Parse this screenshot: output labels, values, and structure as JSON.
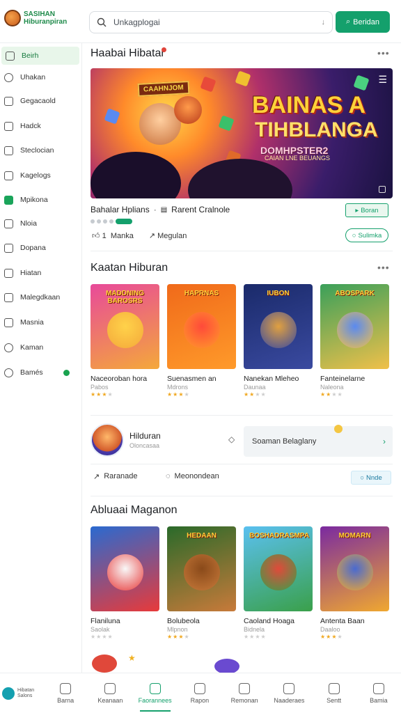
{
  "app": {
    "logo_text": "SASIHAN Hiburanpiran"
  },
  "search": {
    "placeholder": "Unkagplogai",
    "button_label": "Beridan"
  },
  "sidebar": {
    "items": [
      {
        "label": "Beirh",
        "icon": "home-icon",
        "active": true
      },
      {
        "label": "Uhakan",
        "icon": "bell-icon"
      },
      {
        "label": "Gegacaold",
        "icon": "game-icon"
      },
      {
        "label": "Hadck",
        "icon": "folder-icon"
      },
      {
        "label": "Steclocian",
        "icon": "home-outline-icon"
      },
      {
        "label": "Kagelogs",
        "icon": "grid-icon"
      },
      {
        "label": "Mpikona",
        "icon": "app-icon"
      },
      {
        "label": "Nloia",
        "icon": "bookmark-icon"
      },
      {
        "label": "Dopana",
        "icon": "calendar-icon"
      },
      {
        "label": "Hiatan",
        "icon": "box-icon"
      },
      {
        "label": "Malegdkaan",
        "icon": "list-icon"
      },
      {
        "label": "Masnia",
        "icon": "store-icon"
      },
      {
        "label": "Kaman",
        "icon": "gear-icon"
      },
      {
        "label": "Bamés",
        "icon": "help-icon"
      }
    ]
  },
  "featured": {
    "title": "Haabai Hibatar",
    "banner": {
      "sign": "CAAHNJOM",
      "title1": "BAINAS A",
      "title2": "TIHBLANGA",
      "subtitle": "DOMHPSTER2",
      "tagline": "CAIAN LNE BEUANGS"
    },
    "info": {
      "left": "Bahalar Hplians",
      "right": "Rarent Cralnole"
    },
    "play_label": "Boran",
    "actions": {
      "likes": "1",
      "like_label": "Manka",
      "share_label": "Megulan"
    },
    "follow_label": "Sulimka"
  },
  "hiburan": {
    "title": "Kaatan Hiburan",
    "cards": [
      {
        "tag": "MADDNING BAROSRS",
        "name": "Naceoroban hora",
        "sub": "Pabos",
        "stars": 3
      },
      {
        "tag": "HAPRNAS",
        "name": "Suenasmen an",
        "sub": "Mdrons",
        "stars": 3
      },
      {
        "tag": "IUBON",
        "name": "Nanekan Mleheo",
        "sub": "Daunaa",
        "stars": 2
      },
      {
        "tag": "ABOSPARK",
        "name": "Fanteinelarne",
        "sub": "Naleona",
        "stars": 2
      }
    ]
  },
  "profile": {
    "name": "Hilduran",
    "sub": "Oloncasaa",
    "language": "Soaman Belaglany",
    "action1": "Raranade",
    "action2": "Meonondean",
    "chip": "Nnde"
  },
  "aplikasi": {
    "title": "Abluaai Maganon",
    "cards": [
      {
        "tag": "",
        "name": "Flaniluna",
        "sub": "Saolak",
        "stars": 0
      },
      {
        "tag": "HEDAAN",
        "name": "Bolubeola",
        "sub": "Mlpnon",
        "stars": 3
      },
      {
        "tag": "BOSHADRASMPA",
        "name": "Caoland Hoaga",
        "sub": "Bidnela",
        "stars": 0
      },
      {
        "tag": "MOMARN",
        "name": "Antenta Baan",
        "sub": "Daaloo",
        "stars": 3
      }
    ]
  },
  "bottom_nav": {
    "logo_text": "Hibatan Salons",
    "items": [
      {
        "label": "Barna",
        "icon": "home-icon"
      },
      {
        "label": "Keanaan",
        "icon": "search-icon"
      },
      {
        "label": "Faorannees",
        "icon": "play-icon",
        "active": true
      },
      {
        "label": "Rapon",
        "icon": "bag-icon"
      },
      {
        "label": "Remonan",
        "icon": "link-icon"
      },
      {
        "label": "Naaderaes",
        "icon": "edit-icon"
      },
      {
        "label": "Sentt",
        "icon": "clock-icon"
      },
      {
        "label": "Bamia",
        "icon": "user-icon"
      }
    ]
  },
  "colors": {
    "accent": "#14a06c",
    "sidebar_active": "#e8f6ea",
    "star": "#f0a820"
  }
}
